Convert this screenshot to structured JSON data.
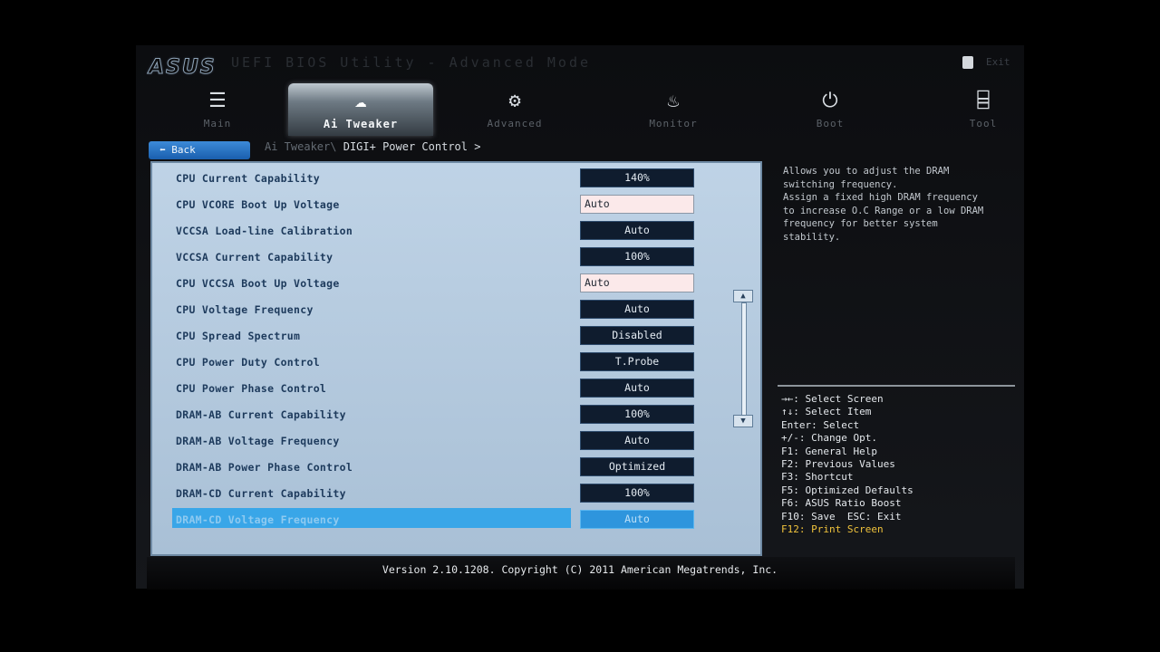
{
  "header": {
    "logo": "ASUS",
    "mode_title": "UEFI BIOS Utility - Advanced Mode",
    "top_right_label": "Exit"
  },
  "tabs": [
    {
      "label": "Main",
      "icon": "list-icon",
      "active": false
    },
    {
      "label": "Ai Tweaker",
      "icon": "tweaker-icon",
      "active": true
    },
    {
      "label": "Advanced",
      "icon": "advanced-icon",
      "active": false
    },
    {
      "label": "Monitor",
      "icon": "monitor-icon",
      "active": false
    },
    {
      "label": "Boot",
      "icon": "power-icon",
      "active": false
    },
    {
      "label": "Tool",
      "icon": "tool-icon",
      "active": false
    }
  ],
  "nav": {
    "back_label": "Back",
    "breadcrumb_parent": "Ai Tweaker\\",
    "breadcrumb_current": "DIGI+ Power Control >"
  },
  "settings": [
    {
      "label": "CPU Current Capability",
      "value": "140%"
    },
    {
      "label": "CPU VCORE Boot Up Voltage",
      "value": "Auto"
    },
    {
      "label": "VCCSA Load-line Calibration",
      "value": "Auto"
    },
    {
      "label": "VCCSA Current Capability",
      "value": "100%"
    },
    {
      "label": "CPU VCCSA Boot Up Voltage",
      "value": "Auto"
    },
    {
      "label": "CPU Voltage Frequency",
      "value": "Auto"
    },
    {
      "label": "CPU Spread Spectrum",
      "value": "Disabled"
    },
    {
      "label": "CPU Power Duty Control",
      "value": "T.Probe"
    },
    {
      "label": "CPU Power Phase Control",
      "value": "Auto"
    },
    {
      "label": "DRAM-AB Current Capability",
      "value": "100%"
    },
    {
      "label": "DRAM-AB Voltage Frequency",
      "value": "Auto"
    },
    {
      "label": "DRAM-AB Power Phase Control",
      "value": "Optimized"
    },
    {
      "label": "DRAM-CD Current Capability",
      "value": "100%"
    },
    {
      "label": "DRAM-CD Voltage Frequency",
      "value": "Auto"
    }
  ],
  "help": {
    "text": "Allows you to adjust the DRAM\nswitching frequency.\nAssign a fixed high DRAM frequency\nto increase O.C Range or a low DRAM\nfrequency for better system\nstability."
  },
  "keys": [
    "→←: Select Screen",
    "↑↓: Select Item",
    "Enter: Select",
    "+/-: Change Opt.",
    "F1: General Help",
    "F2: Previous Values",
    "F3: Shortcut",
    "F5: Optimized Defaults",
    "F6: ASUS Ratio Boost",
    "F10: Save  ESC: Exit"
  ],
  "print_screen_key": "F12: Print Screen",
  "footer": "Version 2.10.1208. Copyright (C) 2011 American Megatrends, Inc."
}
